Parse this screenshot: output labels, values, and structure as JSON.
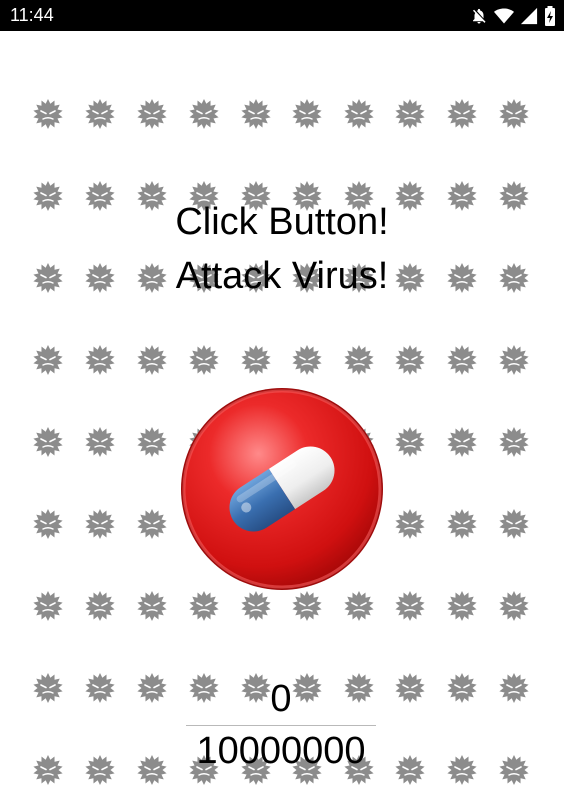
{
  "status_bar": {
    "time": "11:44",
    "icons": [
      "notifications-off-icon",
      "wifi-icon",
      "cellular-signal-icon",
      "battery-charging-icon"
    ]
  },
  "background": {
    "icon": "virus-icon",
    "color": "#8c8c8c"
  },
  "instructions": {
    "line1": "Click Button!",
    "line2": "Attack Virus!"
  },
  "attack_button": {
    "icon": "pill-capsule-icon",
    "colors": {
      "button": "#e01b1b",
      "capsule_blue": "#3a6fb0",
      "capsule_white": "#f2f2f2"
    }
  },
  "counter": {
    "current": "0",
    "total": "10000000",
    "progress": 0
  }
}
